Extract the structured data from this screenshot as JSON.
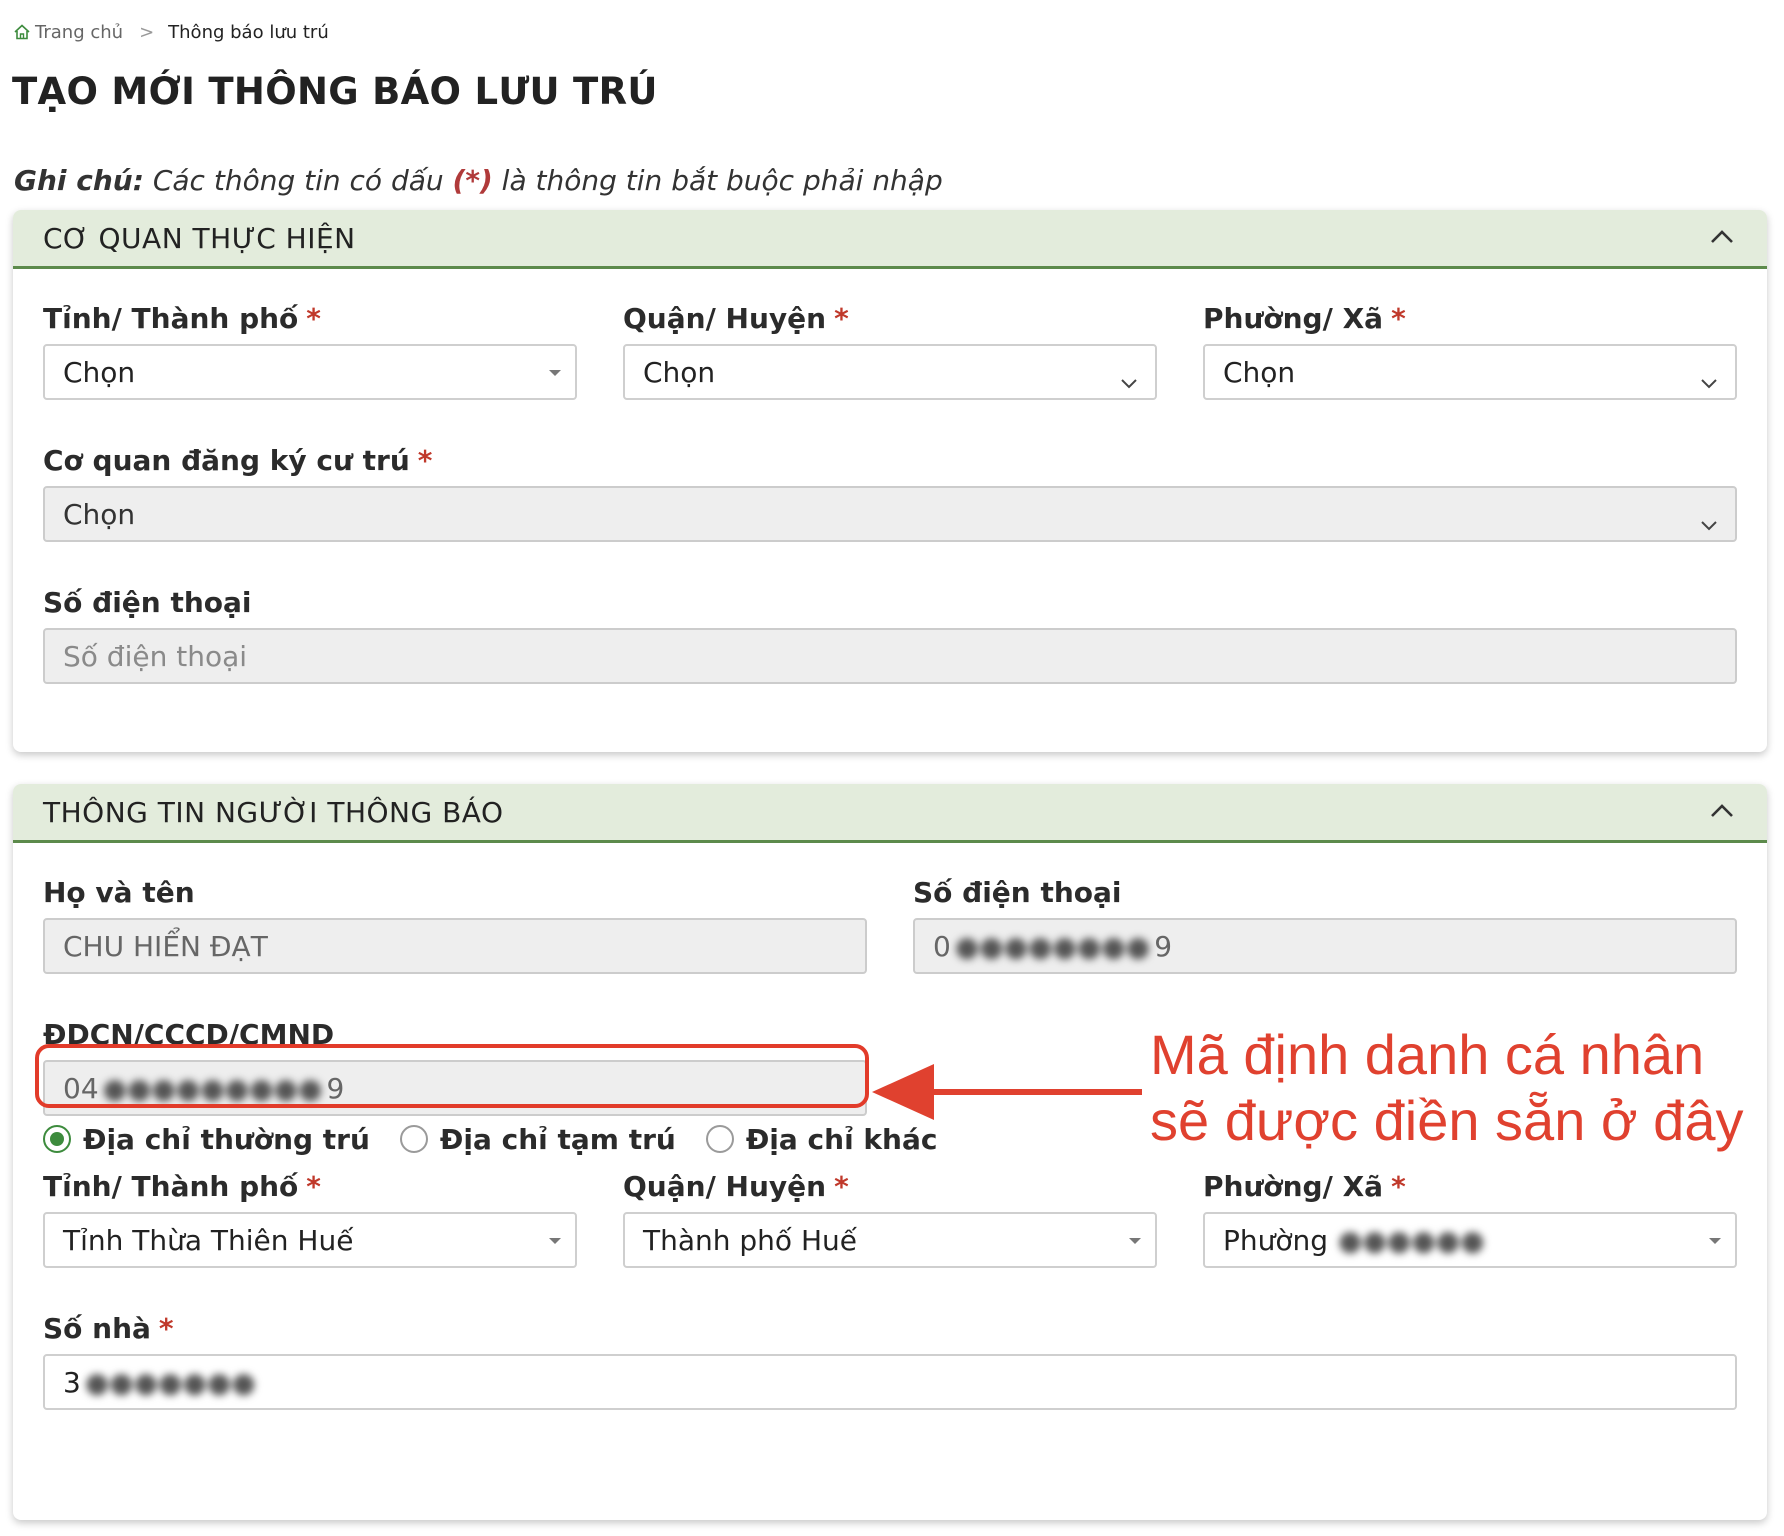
{
  "breadcrumb": {
    "home": "Trang chủ",
    "separator": ">",
    "current": "Thông báo lưu trú"
  },
  "page_title": "TẠO MỚI THÔNG BÁO LƯU TRÚ",
  "note": {
    "label": "Ghi chú:",
    "text_before": " Các thông tin có dấu ",
    "mark": "(*)",
    "text_after": " là thông tin bắt buộc phải nhập"
  },
  "required_mark": "*",
  "section_agency": {
    "title": "CƠ QUAN THỰC HIỆN",
    "province": {
      "label": "Tỉnh/ Thành phố",
      "value": "Chọn"
    },
    "district": {
      "label": "Quận/ Huyện",
      "value": "Chọn"
    },
    "ward": {
      "label": "Phường/ Xã",
      "value": "Chọn"
    },
    "registration_office": {
      "label": "Cơ quan đăng ký cư trú",
      "value": "Chọn"
    },
    "phone": {
      "label": "Số điện thoại",
      "placeholder": "Số điện thoại"
    }
  },
  "section_notifier": {
    "title": "THÔNG TIN NGƯỜI THÔNG BÁO",
    "full_name": {
      "label": "Họ và tên",
      "value": "CHU HIỂN ĐẠT"
    },
    "phone": {
      "label": "Số điện thoại",
      "value_start": "0",
      "value_end": "9"
    },
    "id_number": {
      "label": "ĐDCN/CCCD/CMND",
      "value_start": "04",
      "value_end": "9"
    },
    "address_types": [
      {
        "label": "Địa chỉ thường trú",
        "checked": true
      },
      {
        "label": "Địa chỉ tạm trú",
        "checked": false
      },
      {
        "label": "Địa chỉ khác",
        "checked": false
      }
    ],
    "province": {
      "label": "Tỉnh/ Thành phố",
      "value": "Tỉnh Thừa Thiên Huế"
    },
    "district": {
      "label": "Quận/ Huyện",
      "value": "Thành phố Huế"
    },
    "ward": {
      "label": "Phường/ Xã",
      "value_prefix": "Phường"
    },
    "house_number": {
      "label": "Số nhà",
      "value_start": "3"
    }
  },
  "annotation": {
    "line1": "Mã định danh cá nhân",
    "line2": "sẽ được điền sẵn ở đây",
    "color": "#e0412f"
  },
  "colors": {
    "section_header_bg": "#e3ecdc",
    "section_header_border": "#5c8a4b",
    "required": "#c0392b",
    "radio_checked": "#3d8b3d"
  }
}
